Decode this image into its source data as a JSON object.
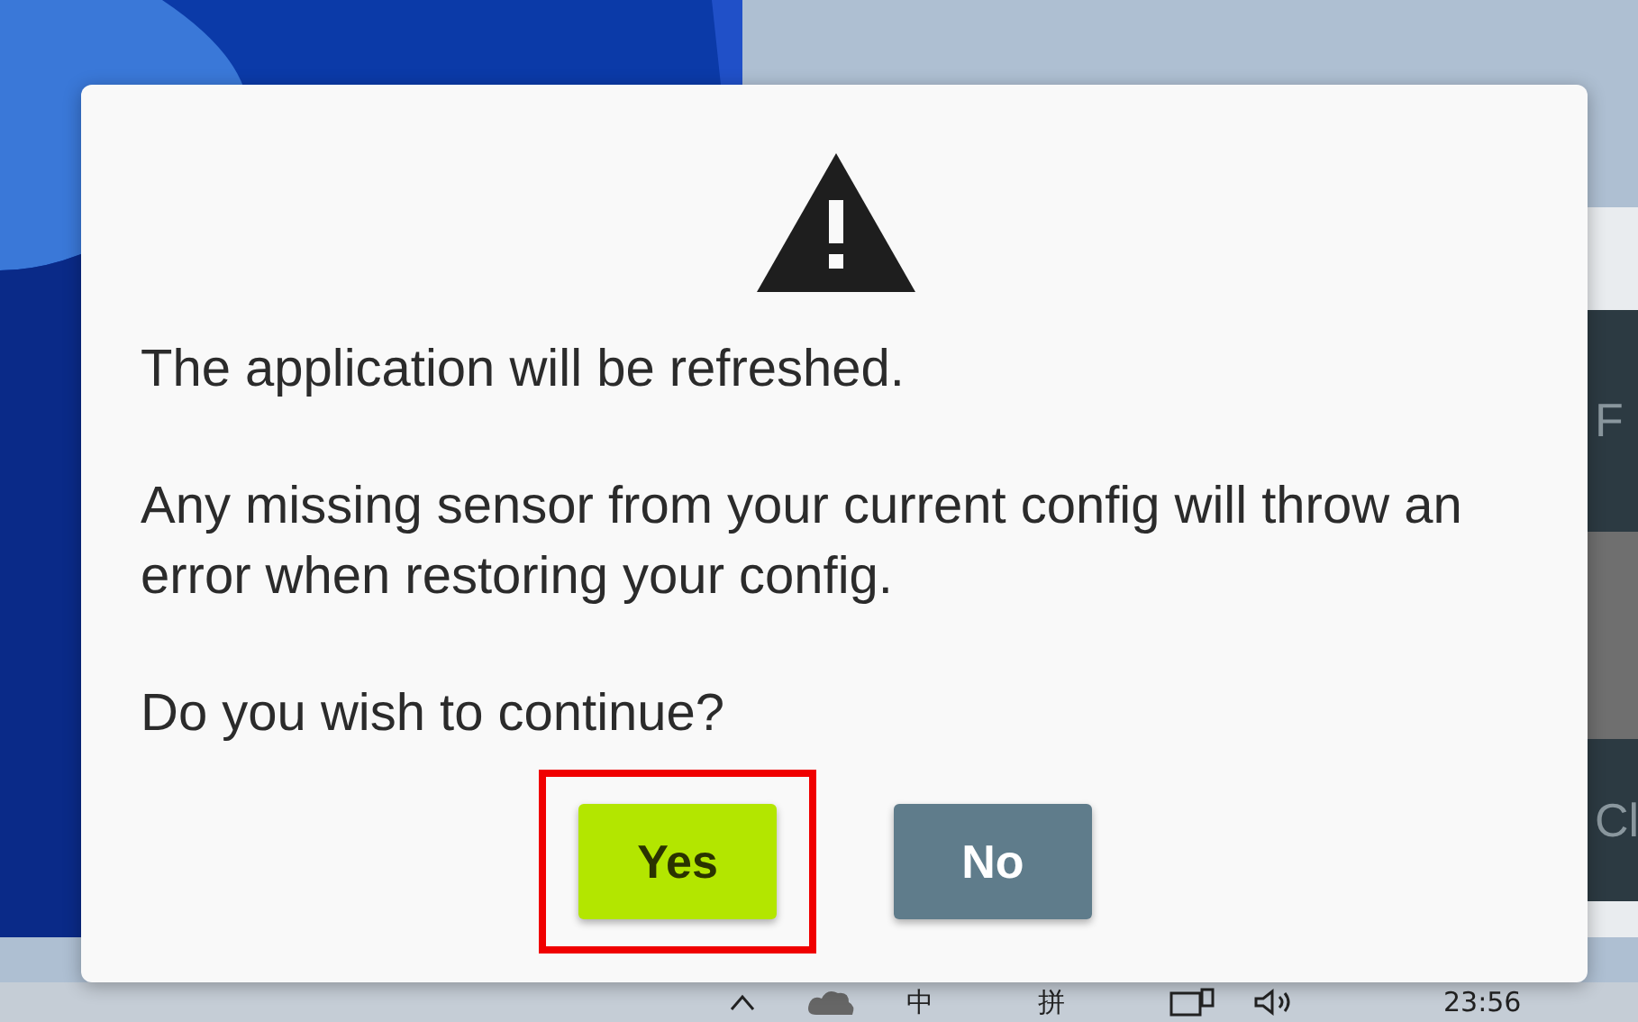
{
  "background_window": {
    "panels": [
      {
        "label": "F"
      },
      {
        "label": "Cl"
      }
    ]
  },
  "dialog": {
    "messages": [
      "The application will be refreshed.",
      "Any missing sensor from your current config will throw an error when restoring your config.",
      "Do you wish to continue?"
    ],
    "buttons": [
      {
        "label": "Yes",
        "kind": "confirm",
        "highlighted": true
      },
      {
        "label": "No",
        "kind": "cancel",
        "highlighted": false
      }
    ]
  },
  "taskbar": {
    "ime_mode": "中",
    "ime_name": "拼",
    "clock": "23:56"
  }
}
